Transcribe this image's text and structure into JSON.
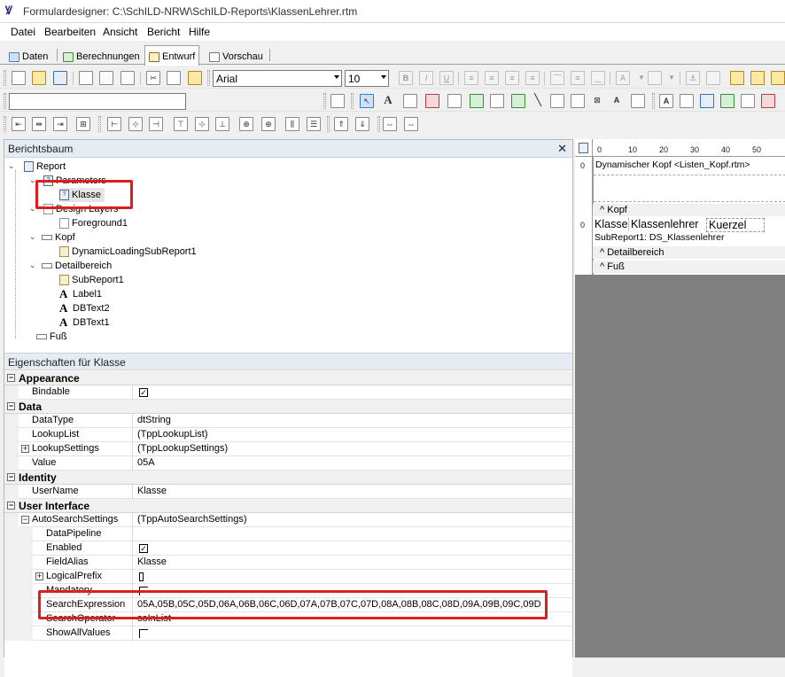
{
  "window": {
    "title": "Formulardesigner: C:\\SchILD-NRW\\SchILD-Reports\\KlassenLehrer.rtm"
  },
  "menu": [
    "Datei",
    "Bearbeiten",
    "Ansicht",
    "Bericht",
    "Hilfe"
  ],
  "tabs": [
    {
      "label": "Daten",
      "active": false
    },
    {
      "label": "Berechnungen",
      "active": false
    },
    {
      "label": "Entwurf",
      "active": true
    },
    {
      "label": "Vorschau",
      "active": false
    }
  ],
  "toolbar": {
    "font_name": "Arial",
    "font_size": "10"
  },
  "tree_panel": {
    "title": "Berichtsbaum",
    "nodes": {
      "report": "Report",
      "parameters": "Parameters",
      "klasse": "Klasse",
      "design_layers": "Design Layers",
      "foreground": "Foreground1",
      "kopf": "Kopf",
      "dynamic": "DynamicLoadingSubReport1",
      "detail": "Detailbereich",
      "subreport": "SubReport1",
      "label": "Label1",
      "dbtext2": "DBText2",
      "dbtext1": "DBText1",
      "fuss": "Fuß"
    }
  },
  "properties": {
    "title": "Eigenschaften für Klasse",
    "appearance": {
      "category": "Appearance",
      "bindable": "Bindable"
    },
    "data": {
      "category": "Data",
      "datatype_name": "DataType",
      "datatype_value": "dtString",
      "lookuplist_name": "LookupList",
      "lookuplist_value": "(TppLookupList)",
      "lookupsettings_name": "LookupSettings",
      "lookupsettings_value": "(TppLookupSettings)",
      "value_name": "Value",
      "value_value": "05A"
    },
    "identity": {
      "category": "Identity",
      "username_name": "UserName",
      "username_value": "Klasse"
    },
    "ui": {
      "category": "User Interface",
      "autosearch_name": "AutoSearchSettings",
      "autosearch_value": "(TppAutoSearchSettings)",
      "datapipeline_name": "DataPipeline",
      "enabled_name": "Enabled",
      "fieldalias_name": "FieldAlias",
      "fieldalias_value": "Klasse",
      "logicalprefix_name": "LogicalPrefix",
      "mandatory_name": "Mandatory",
      "searchexpression_name": "SearchExpression",
      "searchexpression_value": "05A,05B,05C,05D,06A,06B,06C,06D,07A,07B,07C,07D,08A,08B,08C,08D,09A,09B,09C,09D",
      "searchoperator_name": "SearchOperator",
      "searchoperator_value": "soInList",
      "showallvalues_name": "ShowAllValues"
    }
  },
  "design": {
    "ruler_ticks": [
      "0",
      "10",
      "20",
      "30",
      "40",
      "50"
    ],
    "dyn_header": "Dynamischer Kopf <Listen_Kopf.rtm>",
    "band_kopf": "Kopf",
    "label_klasse": "Klasse",
    "label_klassenlehrer": "Klassenlehrer",
    "label_kuerzel": "Kuerzel",
    "subreport_text": "SubReport1: DS_Klassenlehrer",
    "band_detail": "Detailbereich",
    "band_fuss": "Fuß",
    "ruler_zero": "0",
    "ruler_zero2": "0"
  }
}
